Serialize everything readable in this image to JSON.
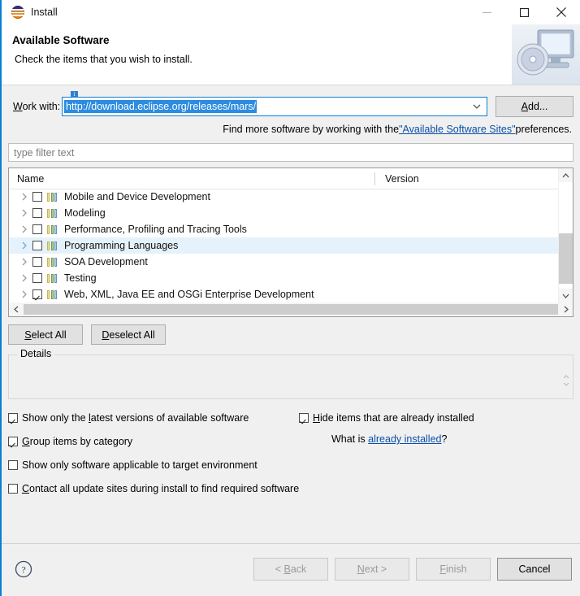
{
  "window": {
    "title": "Install",
    "icon": "eclipse-icon",
    "controls": {
      "minimize": "minimize-icon",
      "maximize": "maximize-icon",
      "close": "close-icon"
    }
  },
  "header": {
    "title": "Available Software",
    "subtitle": "Check the items that you wish to install.",
    "banner_icon": "monitor-cd-icon"
  },
  "work_with": {
    "label": "Work with:",
    "value": "http://download.eclipse.org/releases/mars/",
    "add_button": "Add...",
    "caret_icon": "chevron-down-icon",
    "info_icon": "info-icon"
  },
  "hint": {
    "prefix": "Find more software by working with the ",
    "link": "\"Available Software Sites\"",
    "suffix": " preferences."
  },
  "filter": {
    "placeholder": "type filter text",
    "value": ""
  },
  "tree": {
    "columns": [
      "Name",
      "Version"
    ],
    "rows": [
      {
        "label": "Mobile and Device Development",
        "version": "",
        "checked": false,
        "selected": false
      },
      {
        "label": "Modeling",
        "version": "",
        "checked": false,
        "selected": false
      },
      {
        "label": "Performance, Profiling and Tracing Tools",
        "version": "",
        "checked": false,
        "selected": false
      },
      {
        "label": "Programming Languages",
        "version": "",
        "checked": false,
        "selected": true
      },
      {
        "label": "SOA Development",
        "version": "",
        "checked": false,
        "selected": false
      },
      {
        "label": "Testing",
        "version": "",
        "checked": false,
        "selected": false
      },
      {
        "label": "Web, XML, Java EE and OSGi Enterprise Development",
        "version": "",
        "checked": true,
        "selected": false
      }
    ],
    "expand_icon": "chevron-right-icon",
    "item_icon": "category-icon"
  },
  "selection_buttons": {
    "select_all": "Select All",
    "deselect_all": "Deselect All"
  },
  "details": {
    "legend": "Details",
    "text": ""
  },
  "options": [
    {
      "label_pre": "Show only the ",
      "mnemonic": "l",
      "label_post": "atest versions of available software",
      "checked": true
    },
    {
      "label_pre": "",
      "mnemonic": "G",
      "label_post": "roup items by category",
      "checked": true
    },
    {
      "label_pre": "Show only software applicable to target environment",
      "mnemonic": "",
      "label_post": "",
      "checked": false
    },
    {
      "label_pre": "",
      "mnemonic": "C",
      "label_post": "ontact all update sites during install to find required software",
      "checked": false
    }
  ],
  "options_right": {
    "hide_installed": {
      "label_pre": "",
      "mnemonic": "H",
      "label_post": "ide items that are already installed",
      "checked": true
    },
    "what_is_prefix": "What is ",
    "what_is_link": "already installed",
    "what_is_suffix": "?"
  },
  "footer": {
    "help_icon": "help-icon",
    "buttons": [
      {
        "label": "< Back",
        "enabled": false
      },
      {
        "label": "Next >",
        "enabled": false
      },
      {
        "label": "Finish",
        "enabled": false
      },
      {
        "label": "Cancel",
        "enabled": true
      }
    ]
  },
  "colors": {
    "accent": "#0a7fd6",
    "selection": "#2d8ce0",
    "link": "#0b4fa8",
    "row_selected": "#e5f2fb"
  }
}
